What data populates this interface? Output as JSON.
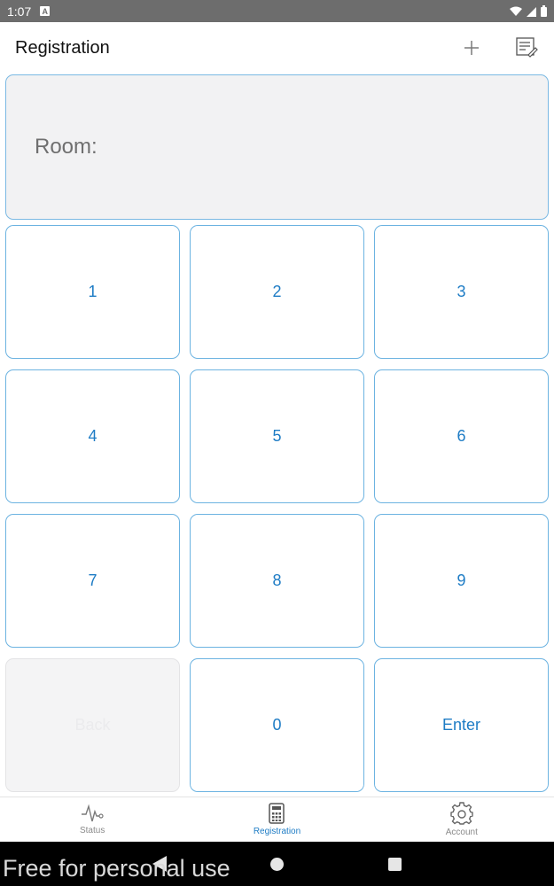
{
  "status_bar": {
    "time": "1:07",
    "notification_letter": "A"
  },
  "app_bar": {
    "title": "Registration",
    "actions": [
      {
        "name": "add-icon"
      },
      {
        "name": "edit-list-icon"
      }
    ]
  },
  "display": {
    "label": "Room:",
    "value": ""
  },
  "keypad": {
    "keys": [
      "1",
      "2",
      "3",
      "4",
      "5",
      "6",
      "7",
      "8",
      "9",
      "Back",
      "0",
      "Enter"
    ],
    "disabled_key": "Back"
  },
  "bottom_nav": {
    "items": [
      {
        "label": "Status",
        "icon": "pulse-icon",
        "active": false
      },
      {
        "label": "Registration",
        "icon": "calculator-icon",
        "active": true
      },
      {
        "label": "Account",
        "icon": "gear-icon",
        "active": false
      }
    ]
  },
  "system_nav": {
    "watermark": "Free for personal use"
  },
  "colors": {
    "accent": "#1e7cc5",
    "key_border": "#6cb3e1",
    "display_bg": "#f2f2f3",
    "status_bar_bg": "#6d6d6d"
  }
}
